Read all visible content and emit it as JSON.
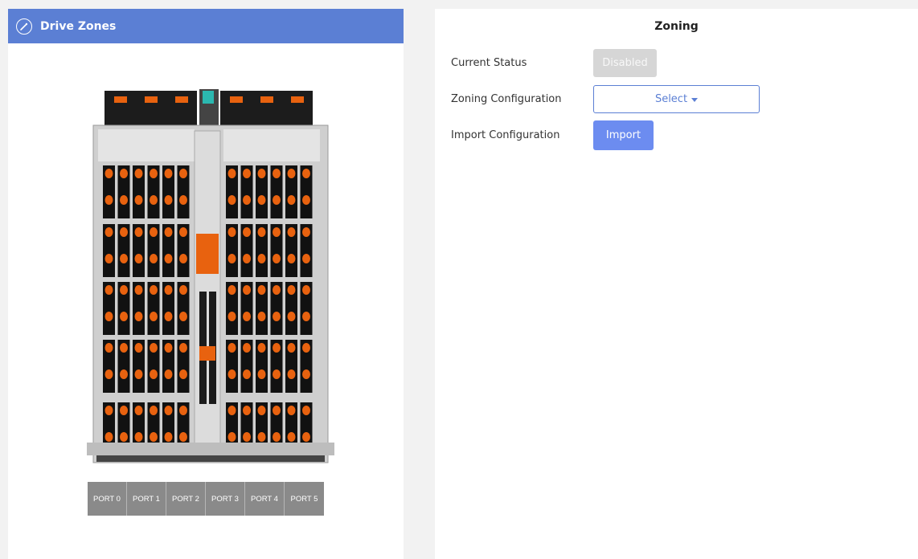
{
  "left_panel": {
    "title": "Drive Zones",
    "header_icon": "gauge-icon",
    "image_name": "drive-enclosure-image",
    "ports": [
      "PORT 0",
      "PORT 1",
      "PORT 2",
      "PORT 3",
      "PORT 4",
      "PORT 5"
    ]
  },
  "right_panel": {
    "title": "Zoning",
    "rows": [
      {
        "label": "Current Status",
        "control": "Disabled"
      },
      {
        "label": "Zoning Configuration",
        "control": "Select"
      },
      {
        "label": "Import Configuration",
        "control": "Import"
      }
    ]
  },
  "colors": {
    "header_bg": "#5b7fd4",
    "primary": "#6c8cf0",
    "port_bg": "#8a8a8a",
    "drive_orange": "#e8620f"
  }
}
